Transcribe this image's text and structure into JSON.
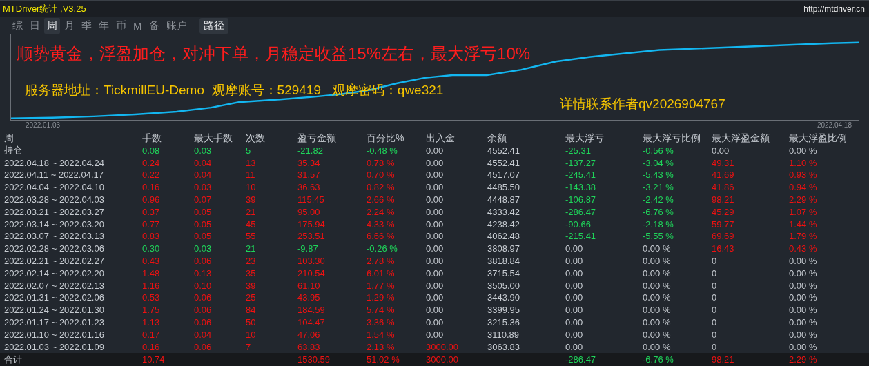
{
  "window": {
    "title": "MTDriver统计 ,V3.25",
    "url": "http://mtdriver.cn"
  },
  "tabs": [
    {
      "label": "综",
      "selected": false
    },
    {
      "label": "日",
      "selected": false
    },
    {
      "label": "周",
      "selected": true
    },
    {
      "label": "月",
      "selected": false
    },
    {
      "label": "季",
      "selected": false
    },
    {
      "label": "年",
      "selected": false
    },
    {
      "label": "币",
      "selected": false
    },
    {
      "label": "M",
      "selected": false
    },
    {
      "label": "备",
      "selected": false
    },
    {
      "label": "账户",
      "selected": false
    }
  ],
  "path_button": {
    "label": "路径"
  },
  "chart": {
    "headline": "顺势黄金，浮盈加仓，对冲下单，月稳定收益15%左右，最大浮亏10%",
    "server_line": "服务器地址：TickmillEU-Demo  观摩账号：529419   观摩密码：qwe321",
    "contact": "详情联系作者qv2026904767",
    "start_date": "2022.01.03",
    "end_date": "2022.04.18"
  },
  "table": {
    "columns": [
      "周",
      "手数",
      "最大手数",
      "次数",
      "盈亏金额",
      "百分比%",
      "出入金",
      "余额",
      "最大浮亏",
      "最大浮亏比例",
      "最大浮盈金额",
      "最大浮盈比例"
    ],
    "rows": [
      {
        "kind": "holding",
        "cells": [
          {
            "text": "持仓",
            "color": "#c7ccd2"
          },
          {
            "text": "0.08",
            "color": "#1fd45a"
          },
          {
            "text": "0.03",
            "color": "#1fd45a"
          },
          {
            "text": "5",
            "color": "#1fd45a"
          },
          {
            "text": "-21.82",
            "color": "#1fd45a"
          },
          {
            "text": "-0.48 %",
            "color": "#1fd45a"
          },
          {
            "text": "0.00",
            "color": "#c7ccd2"
          },
          {
            "text": "4552.41",
            "color": "#c7ccd2"
          },
          {
            "text": "-25.31",
            "color": "#1fd45a"
          },
          {
            "text": "-0.56 %",
            "color": "#1fd45a"
          },
          {
            "text": "0.00",
            "color": "#c7ccd2"
          },
          {
            "text": "0.00 %",
            "color": "#c7ccd2"
          }
        ]
      },
      {
        "kind": "week",
        "cells": [
          {
            "text": "2022.04.18 ~ 2022.04.24",
            "color": "#c7ccd2"
          },
          {
            "text": "0.24",
            "color": "#ee1111"
          },
          {
            "text": "0.04",
            "color": "#ee1111"
          },
          {
            "text": "13",
            "color": "#ee1111"
          },
          {
            "text": "35.34",
            "color": "#ee1111"
          },
          {
            "text": "0.78 %",
            "color": "#ee1111"
          },
          {
            "text": "0.00",
            "color": "#c7ccd2"
          },
          {
            "text": "4552.41",
            "color": "#c7ccd2"
          },
          {
            "text": "-137.27",
            "color": "#1fd45a"
          },
          {
            "text": "-3.04 %",
            "color": "#1fd45a"
          },
          {
            "text": "49.31",
            "color": "#ee1111"
          },
          {
            "text": "1.10 %",
            "color": "#ee1111"
          }
        ]
      },
      {
        "kind": "week",
        "cells": [
          {
            "text": "2022.04.11 ~ 2022.04.17",
            "color": "#c7ccd2"
          },
          {
            "text": "0.22",
            "color": "#ee1111"
          },
          {
            "text": "0.04",
            "color": "#ee1111"
          },
          {
            "text": "11",
            "color": "#ee1111"
          },
          {
            "text": "31.57",
            "color": "#ee1111"
          },
          {
            "text": "0.70 %",
            "color": "#ee1111"
          },
          {
            "text": "0.00",
            "color": "#c7ccd2"
          },
          {
            "text": "4517.07",
            "color": "#c7ccd2"
          },
          {
            "text": "-245.41",
            "color": "#1fd45a"
          },
          {
            "text": "-5.43 %",
            "color": "#1fd45a"
          },
          {
            "text": "41.69",
            "color": "#ee1111"
          },
          {
            "text": "0.93 %",
            "color": "#ee1111"
          }
        ]
      },
      {
        "kind": "week",
        "cells": [
          {
            "text": "2022.04.04 ~ 2022.04.10",
            "color": "#c7ccd2"
          },
          {
            "text": "0.16",
            "color": "#ee1111"
          },
          {
            "text": "0.03",
            "color": "#ee1111"
          },
          {
            "text": "10",
            "color": "#ee1111"
          },
          {
            "text": "36.63",
            "color": "#ee1111"
          },
          {
            "text": "0.82 %",
            "color": "#ee1111"
          },
          {
            "text": "0.00",
            "color": "#c7ccd2"
          },
          {
            "text": "4485.50",
            "color": "#c7ccd2"
          },
          {
            "text": "-143.38",
            "color": "#1fd45a"
          },
          {
            "text": "-3.21 %",
            "color": "#1fd45a"
          },
          {
            "text": "41.86",
            "color": "#ee1111"
          },
          {
            "text": "0.94 %",
            "color": "#ee1111"
          }
        ]
      },
      {
        "kind": "week",
        "cells": [
          {
            "text": "2022.03.28 ~ 2022.04.03",
            "color": "#c7ccd2"
          },
          {
            "text": "0.96",
            "color": "#ee1111"
          },
          {
            "text": "0.07",
            "color": "#ee1111"
          },
          {
            "text": "39",
            "color": "#ee1111"
          },
          {
            "text": "115.45",
            "color": "#ee1111"
          },
          {
            "text": "2.66 %",
            "color": "#ee1111"
          },
          {
            "text": "0.00",
            "color": "#c7ccd2"
          },
          {
            "text": "4448.87",
            "color": "#c7ccd2"
          },
          {
            "text": "-106.87",
            "color": "#1fd45a"
          },
          {
            "text": "-2.42 %",
            "color": "#1fd45a"
          },
          {
            "text": "98.21",
            "color": "#ee1111"
          },
          {
            "text": "2.29 %",
            "color": "#ee1111"
          }
        ]
      },
      {
        "kind": "week",
        "cells": [
          {
            "text": "2022.03.21 ~ 2022.03.27",
            "color": "#c7ccd2"
          },
          {
            "text": "0.37",
            "color": "#ee1111"
          },
          {
            "text": "0.05",
            "color": "#ee1111"
          },
          {
            "text": "21",
            "color": "#ee1111"
          },
          {
            "text": "95.00",
            "color": "#ee1111"
          },
          {
            "text": "2.24 %",
            "color": "#ee1111"
          },
          {
            "text": "0.00",
            "color": "#c7ccd2"
          },
          {
            "text": "4333.42",
            "color": "#c7ccd2"
          },
          {
            "text": "-286.47",
            "color": "#1fd45a"
          },
          {
            "text": "-6.76 %",
            "color": "#1fd45a"
          },
          {
            "text": "45.29",
            "color": "#ee1111"
          },
          {
            "text": "1.07 %",
            "color": "#ee1111"
          }
        ]
      },
      {
        "kind": "week",
        "cells": [
          {
            "text": "2022.03.14 ~ 2022.03.20",
            "color": "#c7ccd2"
          },
          {
            "text": "0.77",
            "color": "#ee1111"
          },
          {
            "text": "0.05",
            "color": "#ee1111"
          },
          {
            "text": "45",
            "color": "#ee1111"
          },
          {
            "text": "175.94",
            "color": "#ee1111"
          },
          {
            "text": "4.33 %",
            "color": "#ee1111"
          },
          {
            "text": "0.00",
            "color": "#c7ccd2"
          },
          {
            "text": "4238.42",
            "color": "#c7ccd2"
          },
          {
            "text": "-90.66",
            "color": "#1fd45a"
          },
          {
            "text": "-2.18 %",
            "color": "#1fd45a"
          },
          {
            "text": "59.77",
            "color": "#ee1111"
          },
          {
            "text": "1.44 %",
            "color": "#ee1111"
          }
        ]
      },
      {
        "kind": "week",
        "cells": [
          {
            "text": "2022.03.07 ~ 2022.03.13",
            "color": "#c7ccd2"
          },
          {
            "text": "0.83",
            "color": "#ee1111"
          },
          {
            "text": "0.05",
            "color": "#ee1111"
          },
          {
            "text": "55",
            "color": "#ee1111"
          },
          {
            "text": "253.51",
            "color": "#ee1111"
          },
          {
            "text": "6.66 %",
            "color": "#ee1111"
          },
          {
            "text": "0.00",
            "color": "#c7ccd2"
          },
          {
            "text": "4062.48",
            "color": "#c7ccd2"
          },
          {
            "text": "-215.41",
            "color": "#1fd45a"
          },
          {
            "text": "-5.55 %",
            "color": "#1fd45a"
          },
          {
            "text": "69.69",
            "color": "#ee1111"
          },
          {
            "text": "1.79 %",
            "color": "#ee1111"
          }
        ]
      },
      {
        "kind": "week",
        "cells": [
          {
            "text": "2022.02.28 ~ 2022.03.06",
            "color": "#c7ccd2"
          },
          {
            "text": "0.30",
            "color": "#1fd45a"
          },
          {
            "text": "0.03",
            "color": "#1fd45a"
          },
          {
            "text": "21",
            "color": "#1fd45a"
          },
          {
            "text": "-9.87",
            "color": "#1fd45a"
          },
          {
            "text": "-0.26 %",
            "color": "#1fd45a"
          },
          {
            "text": "0.00",
            "color": "#c7ccd2"
          },
          {
            "text": "3808.97",
            "color": "#c7ccd2"
          },
          {
            "text": "0.00",
            "color": "#c7ccd2"
          },
          {
            "text": "0.00 %",
            "color": "#c7ccd2"
          },
          {
            "text": "16.43",
            "color": "#ee1111"
          },
          {
            "text": "0.43 %",
            "color": "#ee1111"
          }
        ]
      },
      {
        "kind": "week",
        "cells": [
          {
            "text": "2022.02.21 ~ 2022.02.27",
            "color": "#c7ccd2"
          },
          {
            "text": "0.43",
            "color": "#ee1111"
          },
          {
            "text": "0.06",
            "color": "#ee1111"
          },
          {
            "text": "23",
            "color": "#ee1111"
          },
          {
            "text": "103.30",
            "color": "#ee1111"
          },
          {
            "text": "2.78 %",
            "color": "#ee1111"
          },
          {
            "text": "0.00",
            "color": "#c7ccd2"
          },
          {
            "text": "3818.84",
            "color": "#c7ccd2"
          },
          {
            "text": "0.00",
            "color": "#c7ccd2"
          },
          {
            "text": "0.00 %",
            "color": "#c7ccd2"
          },
          {
            "text": "0",
            "color": "#c7ccd2"
          },
          {
            "text": "0.00 %",
            "color": "#c7ccd2"
          }
        ]
      },
      {
        "kind": "week",
        "cells": [
          {
            "text": "2022.02.14 ~ 2022.02.20",
            "color": "#c7ccd2"
          },
          {
            "text": "1.48",
            "color": "#ee1111"
          },
          {
            "text": "0.13",
            "color": "#ee1111"
          },
          {
            "text": "35",
            "color": "#ee1111"
          },
          {
            "text": "210.54",
            "color": "#ee1111"
          },
          {
            "text": "6.01 %",
            "color": "#ee1111"
          },
          {
            "text": "0.00",
            "color": "#c7ccd2"
          },
          {
            "text": "3715.54",
            "color": "#c7ccd2"
          },
          {
            "text": "0.00",
            "color": "#c7ccd2"
          },
          {
            "text": "0.00 %",
            "color": "#c7ccd2"
          },
          {
            "text": "0",
            "color": "#c7ccd2"
          },
          {
            "text": "0.00 %",
            "color": "#c7ccd2"
          }
        ]
      },
      {
        "kind": "week",
        "cells": [
          {
            "text": "2022.02.07 ~ 2022.02.13",
            "color": "#c7ccd2"
          },
          {
            "text": "1.16",
            "color": "#ee1111"
          },
          {
            "text": "0.10",
            "color": "#ee1111"
          },
          {
            "text": "39",
            "color": "#ee1111"
          },
          {
            "text": "61.10",
            "color": "#ee1111"
          },
          {
            "text": "1.77 %",
            "color": "#ee1111"
          },
          {
            "text": "0.00",
            "color": "#c7ccd2"
          },
          {
            "text": "3505.00",
            "color": "#c7ccd2"
          },
          {
            "text": "0.00",
            "color": "#c7ccd2"
          },
          {
            "text": "0.00 %",
            "color": "#c7ccd2"
          },
          {
            "text": "0",
            "color": "#c7ccd2"
          },
          {
            "text": "0.00 %",
            "color": "#c7ccd2"
          }
        ]
      },
      {
        "kind": "week",
        "cells": [
          {
            "text": "2022.01.31 ~ 2022.02.06",
            "color": "#c7ccd2"
          },
          {
            "text": "0.53",
            "color": "#ee1111"
          },
          {
            "text": "0.06",
            "color": "#ee1111"
          },
          {
            "text": "25",
            "color": "#ee1111"
          },
          {
            "text": "43.95",
            "color": "#ee1111"
          },
          {
            "text": "1.29 %",
            "color": "#ee1111"
          },
          {
            "text": "0.00",
            "color": "#c7ccd2"
          },
          {
            "text": "3443.90",
            "color": "#c7ccd2"
          },
          {
            "text": "0.00",
            "color": "#c7ccd2"
          },
          {
            "text": "0.00 %",
            "color": "#c7ccd2"
          },
          {
            "text": "0",
            "color": "#c7ccd2"
          },
          {
            "text": "0.00 %",
            "color": "#c7ccd2"
          }
        ]
      },
      {
        "kind": "week",
        "cells": [
          {
            "text": "2022.01.24 ~ 2022.01.30",
            "color": "#c7ccd2"
          },
          {
            "text": "1.75",
            "color": "#ee1111"
          },
          {
            "text": "0.06",
            "color": "#ee1111"
          },
          {
            "text": "84",
            "color": "#ee1111"
          },
          {
            "text": "184.59",
            "color": "#ee1111"
          },
          {
            "text": "5.74 %",
            "color": "#ee1111"
          },
          {
            "text": "0.00",
            "color": "#c7ccd2"
          },
          {
            "text": "3399.95",
            "color": "#c7ccd2"
          },
          {
            "text": "0.00",
            "color": "#c7ccd2"
          },
          {
            "text": "0.00 %",
            "color": "#c7ccd2"
          },
          {
            "text": "0",
            "color": "#c7ccd2"
          },
          {
            "text": "0.00 %",
            "color": "#c7ccd2"
          }
        ]
      },
      {
        "kind": "week",
        "cells": [
          {
            "text": "2022.01.17 ~ 2022.01.23",
            "color": "#c7ccd2"
          },
          {
            "text": "1.13",
            "color": "#ee1111"
          },
          {
            "text": "0.06",
            "color": "#ee1111"
          },
          {
            "text": "50",
            "color": "#ee1111"
          },
          {
            "text": "104.47",
            "color": "#ee1111"
          },
          {
            "text": "3.36 %",
            "color": "#ee1111"
          },
          {
            "text": "0.00",
            "color": "#c7ccd2"
          },
          {
            "text": "3215.36",
            "color": "#c7ccd2"
          },
          {
            "text": "0.00",
            "color": "#c7ccd2"
          },
          {
            "text": "0.00 %",
            "color": "#c7ccd2"
          },
          {
            "text": "0",
            "color": "#c7ccd2"
          },
          {
            "text": "0.00 %",
            "color": "#c7ccd2"
          }
        ]
      },
      {
        "kind": "week",
        "cells": [
          {
            "text": "2022.01.10 ~ 2022.01.16",
            "color": "#c7ccd2"
          },
          {
            "text": "0.17",
            "color": "#ee1111"
          },
          {
            "text": "0.04",
            "color": "#ee1111"
          },
          {
            "text": "10",
            "color": "#ee1111"
          },
          {
            "text": "47.06",
            "color": "#ee1111"
          },
          {
            "text": "1.54 %",
            "color": "#ee1111"
          },
          {
            "text": "0.00",
            "color": "#c7ccd2"
          },
          {
            "text": "3110.89",
            "color": "#c7ccd2"
          },
          {
            "text": "0.00",
            "color": "#c7ccd2"
          },
          {
            "text": "0.00 %",
            "color": "#c7ccd2"
          },
          {
            "text": "0",
            "color": "#c7ccd2"
          },
          {
            "text": "0.00 %",
            "color": "#c7ccd2"
          }
        ]
      },
      {
        "kind": "week",
        "cells": [
          {
            "text": "2022.01.03 ~ 2022.01.09",
            "color": "#c7ccd2"
          },
          {
            "text": "0.16",
            "color": "#ee1111"
          },
          {
            "text": "0.06",
            "color": "#ee1111"
          },
          {
            "text": "7",
            "color": "#ee1111"
          },
          {
            "text": "63.83",
            "color": "#ee1111"
          },
          {
            "text": "2.13 %",
            "color": "#ee1111"
          },
          {
            "text": "3000.00",
            "color": "#ee1111"
          },
          {
            "text": "3063.83",
            "color": "#c7ccd2"
          },
          {
            "text": "0.00",
            "color": "#c7ccd2"
          },
          {
            "text": "0.00 %",
            "color": "#c7ccd2"
          },
          {
            "text": "0",
            "color": "#c7ccd2"
          },
          {
            "text": "0.00 %",
            "color": "#c7ccd2"
          }
        ]
      },
      {
        "kind": "total",
        "cells": [
          {
            "text": "合计",
            "color": "#c7ccd2"
          },
          {
            "text": "10.74",
            "color": "#ee1111"
          },
          "",
          "",
          {
            "text": "1530.59",
            "color": "#ee1111"
          },
          {
            "text": "51.02 %",
            "color": "#ee1111"
          },
          {
            "text": "3000.00",
            "color": "#ee1111"
          },
          "",
          {
            "text": "-286.47",
            "color": "#1fd45a"
          },
          {
            "text": "-6.76 %",
            "color": "#1fd45a"
          },
          {
            "text": "98.21",
            "color": "#ee1111"
          },
          {
            "text": "2.29 %",
            "color": "#ee1111"
          }
        ]
      }
    ]
  }
}
